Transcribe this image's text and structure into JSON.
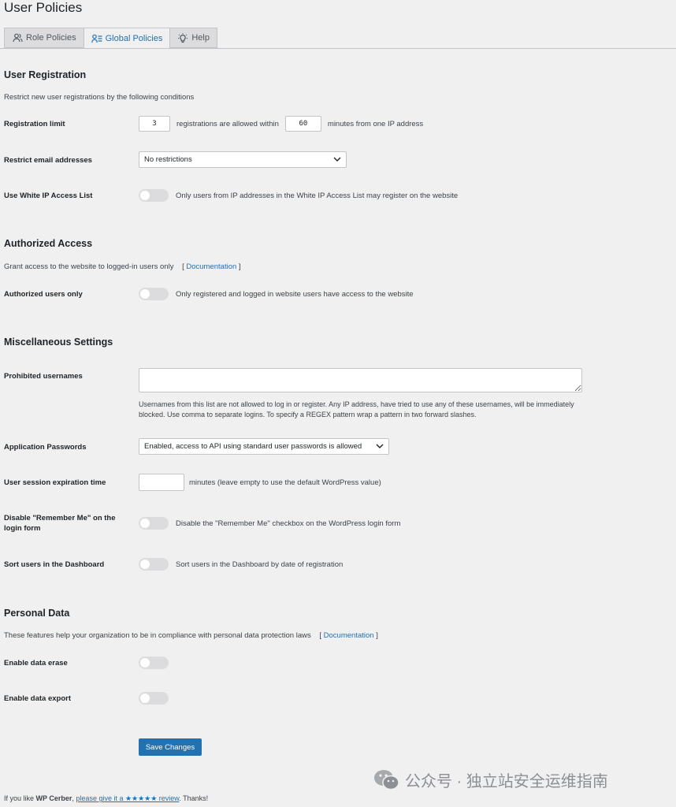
{
  "page": {
    "title": "User Policies"
  },
  "tabs": [
    {
      "label": "Role Policies",
      "icon": "users-icon",
      "active": false
    },
    {
      "label": "Global Policies",
      "icon": "list-settings-icon",
      "active": true
    },
    {
      "label": "Help",
      "icon": "lightbulb-icon",
      "active": false
    }
  ],
  "registration": {
    "title": "User Registration",
    "desc": "Restrict new user registrations by the following conditions",
    "limit": {
      "label": "Registration limit",
      "count": "3",
      "mid_text": "registrations are allowed within",
      "minutes": "60",
      "suffix": "minutes from one IP address"
    },
    "email": {
      "label": "Restrict email addresses",
      "value": "No restrictions"
    },
    "white_ip": {
      "label": "Use White IP Access List",
      "desc": "Only users from IP addresses in the White IP Access List may register on the website",
      "enabled": false
    }
  },
  "authorized": {
    "title": "Authorized Access",
    "desc": "Grant access to the website to logged-in users only",
    "doc_open": "[",
    "doc_link": "Documentation",
    "doc_close": "]",
    "users_only": {
      "label": "Authorized users only",
      "desc": "Only registered and logged in website users have access to the website",
      "enabled": false
    }
  },
  "misc": {
    "title": "Miscellaneous Settings",
    "prohibited": {
      "label": "Prohibited usernames",
      "value": "",
      "hint": "Usernames from this list are not allowed to log in or register. Any IP address, have tried to use any of these usernames, will be immediately blocked. Use comma to separate logins. To specify a REGEX pattern wrap a pattern in two forward slashes."
    },
    "app_passwords": {
      "label": "Application Passwords",
      "value": "Enabled, access to API using standard user passwords is allowed"
    },
    "session": {
      "label": "User session expiration time",
      "value": "",
      "suffix": "minutes (leave empty to use the default WordPress value)"
    },
    "remember_me": {
      "label": "Disable \"Remember Me\" on the login form",
      "desc": "Disable the \"Remember Me\" checkbox on the WordPress login form",
      "enabled": false
    },
    "sort_users": {
      "label": "Sort users in the Dashboard",
      "desc": "Sort users in the Dashboard by date of registration",
      "enabled": false
    }
  },
  "personal": {
    "title": "Personal Data",
    "desc": "These features help your organization to be in compliance with personal data protection laws",
    "doc_open": "[",
    "doc_link": "Documentation",
    "doc_close": "]",
    "erase": {
      "label": "Enable data erase",
      "enabled": false
    },
    "export": {
      "label": "Enable data export",
      "enabled": false
    }
  },
  "save_label": "Save Changes",
  "footer": {
    "prefix": "If you like",
    "brand": "WP Cerber",
    "link": "please give it a ★★★★★ review",
    "suffix": ". Thanks!"
  },
  "watermark": {
    "text": "公众号 · 独立站安全运维指南",
    "icon": "wechat-icon"
  },
  "colors": {
    "accent": "#2271b1",
    "background": "#f0f0f1",
    "toggle_off": "#dcdcde"
  }
}
